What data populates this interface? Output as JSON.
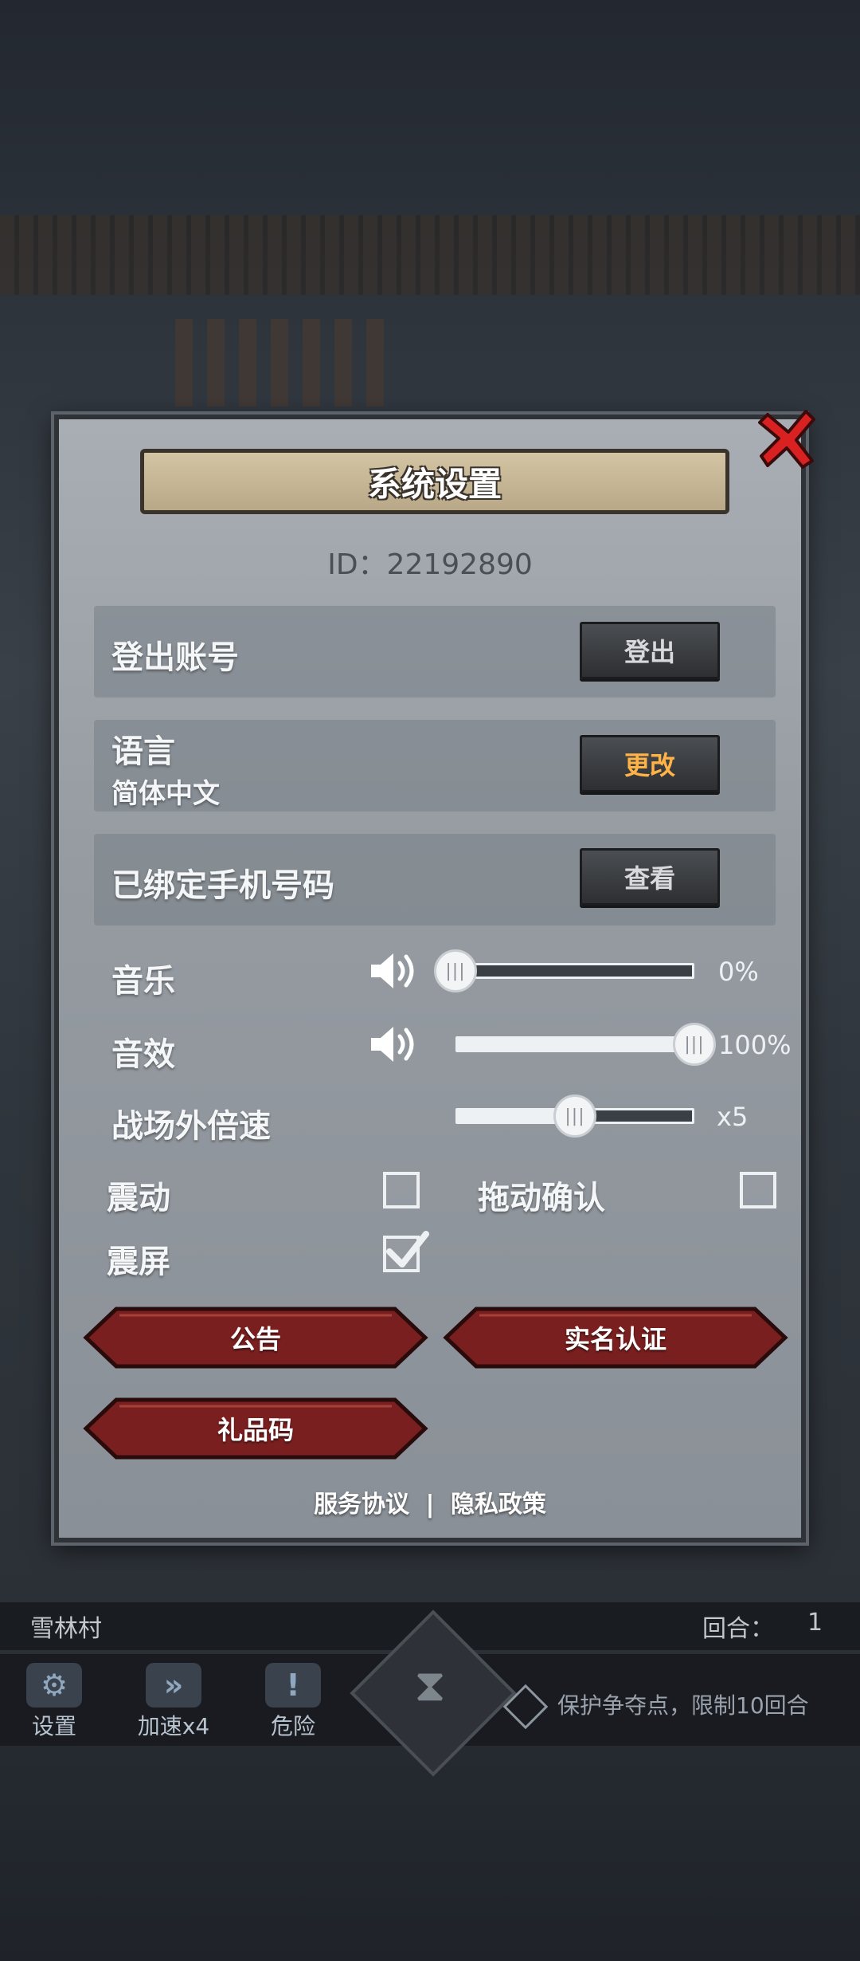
{
  "dialog": {
    "title": "系统设置",
    "id_text": "ID：22192890"
  },
  "account": {
    "label": "登出账号",
    "button": "登出"
  },
  "language": {
    "label": "语言",
    "current": "简体中文",
    "button": "更改"
  },
  "phone": {
    "label": "已绑定手机号码",
    "button": "查看"
  },
  "sliders": {
    "music": {
      "label": "音乐",
      "value_text": "0%",
      "level": 0
    },
    "sfx": {
      "label": "音效",
      "value_text": "100%",
      "level": 1.0
    },
    "speed": {
      "label": "战场外倍速",
      "value_text": "x5",
      "level": 0.5
    }
  },
  "toggles": {
    "vibrate": {
      "label": "震动",
      "checked": false
    },
    "drag_confirm": {
      "label": "拖动确认",
      "checked": false
    },
    "screen_shake": {
      "label": "震屏",
      "checked": true
    }
  },
  "buttons": {
    "notice": "公告",
    "realname": "实名认证",
    "giftcode": "礼品码"
  },
  "footer": {
    "service": "服务协议",
    "separator": "|",
    "privacy": "隐私政策"
  },
  "hud": {
    "village": "雪林村",
    "round_label": "回合：",
    "round_value": "1",
    "settings": "设置",
    "speed": "加速x4",
    "danger": "危险",
    "goal": "保护争夺点，限制10回合"
  },
  "colors": {
    "panel": "#959ba1",
    "accent_orange": "#ffb347",
    "red_button": "#7a1f1f",
    "close_red": "#d92121"
  }
}
